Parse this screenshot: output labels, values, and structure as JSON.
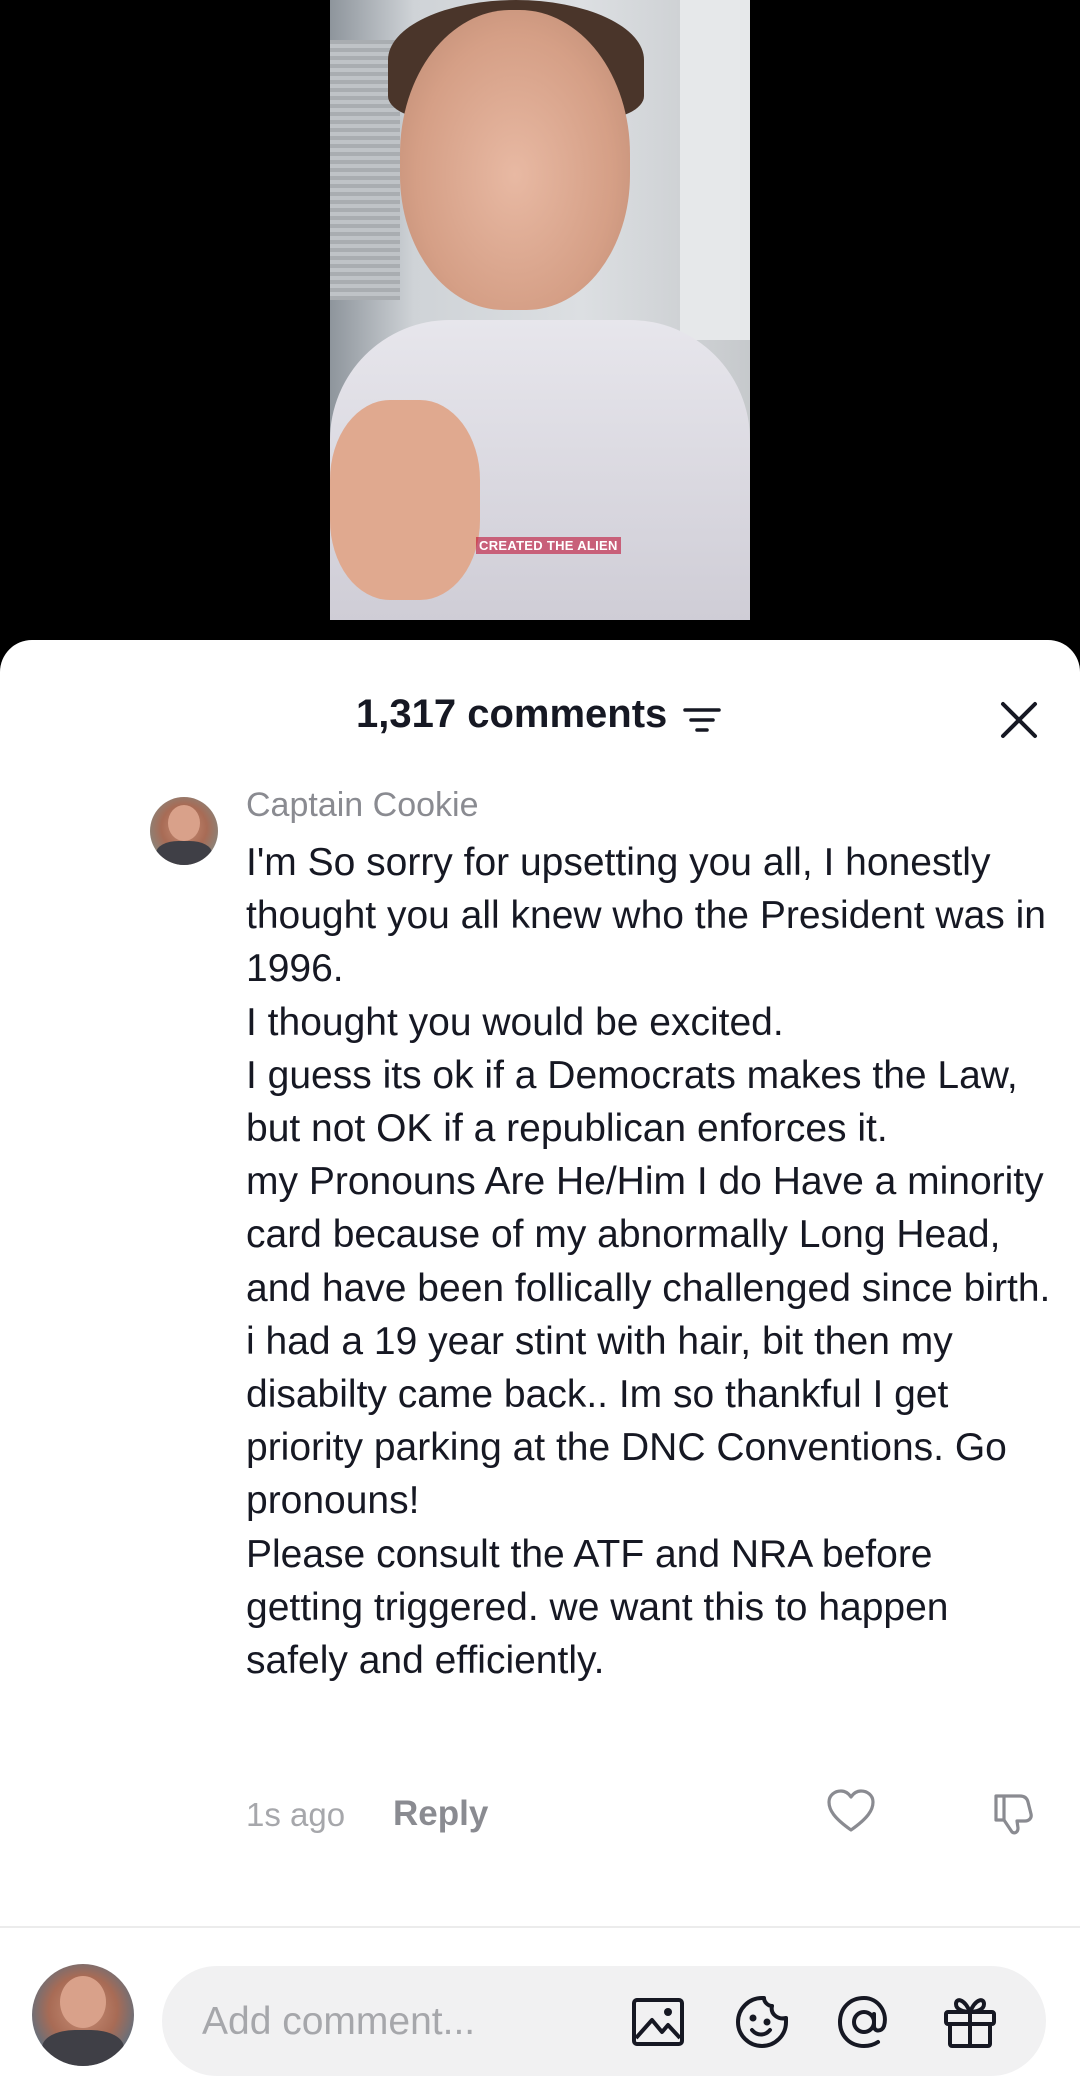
{
  "video": {
    "caption": "CREATED THE ALIEN"
  },
  "comments_sheet": {
    "title": "1,317 comments",
    "icons": {
      "sort": "sort-filter-icon",
      "close": "close-icon"
    }
  },
  "comment": {
    "author": "Captain Cookie",
    "lines": [
      "I'm So sorry for upsetting you all, I honestly thought you all knew who the President was in 1996.",
      "I thought you would be excited.",
      "I guess its ok if a Democrats makes the Law, but not OK if a republican enforces it.",
      "my Pronouns Are He/Him I do Have a minority card because of my abnormally Long Head, and have been follically challenged since birth. i had a 19 year stint with hair, bit then my disabilty came back.. Im so thankful I get priority parking at the DNC Conventions. Go pronouns!",
      "Please consult the ATF and NRA before getting triggered. we want this to happen safely and efficiently."
    ],
    "time": "1s ago",
    "reply_label": "Reply",
    "icons": {
      "like": "heart-icon",
      "dislike": "thumbs-down-icon"
    }
  },
  "composer": {
    "placeholder": "Add comment...",
    "icons": [
      "image-icon",
      "emoji-icon",
      "at-mention-icon",
      "gift-icon"
    ]
  }
}
